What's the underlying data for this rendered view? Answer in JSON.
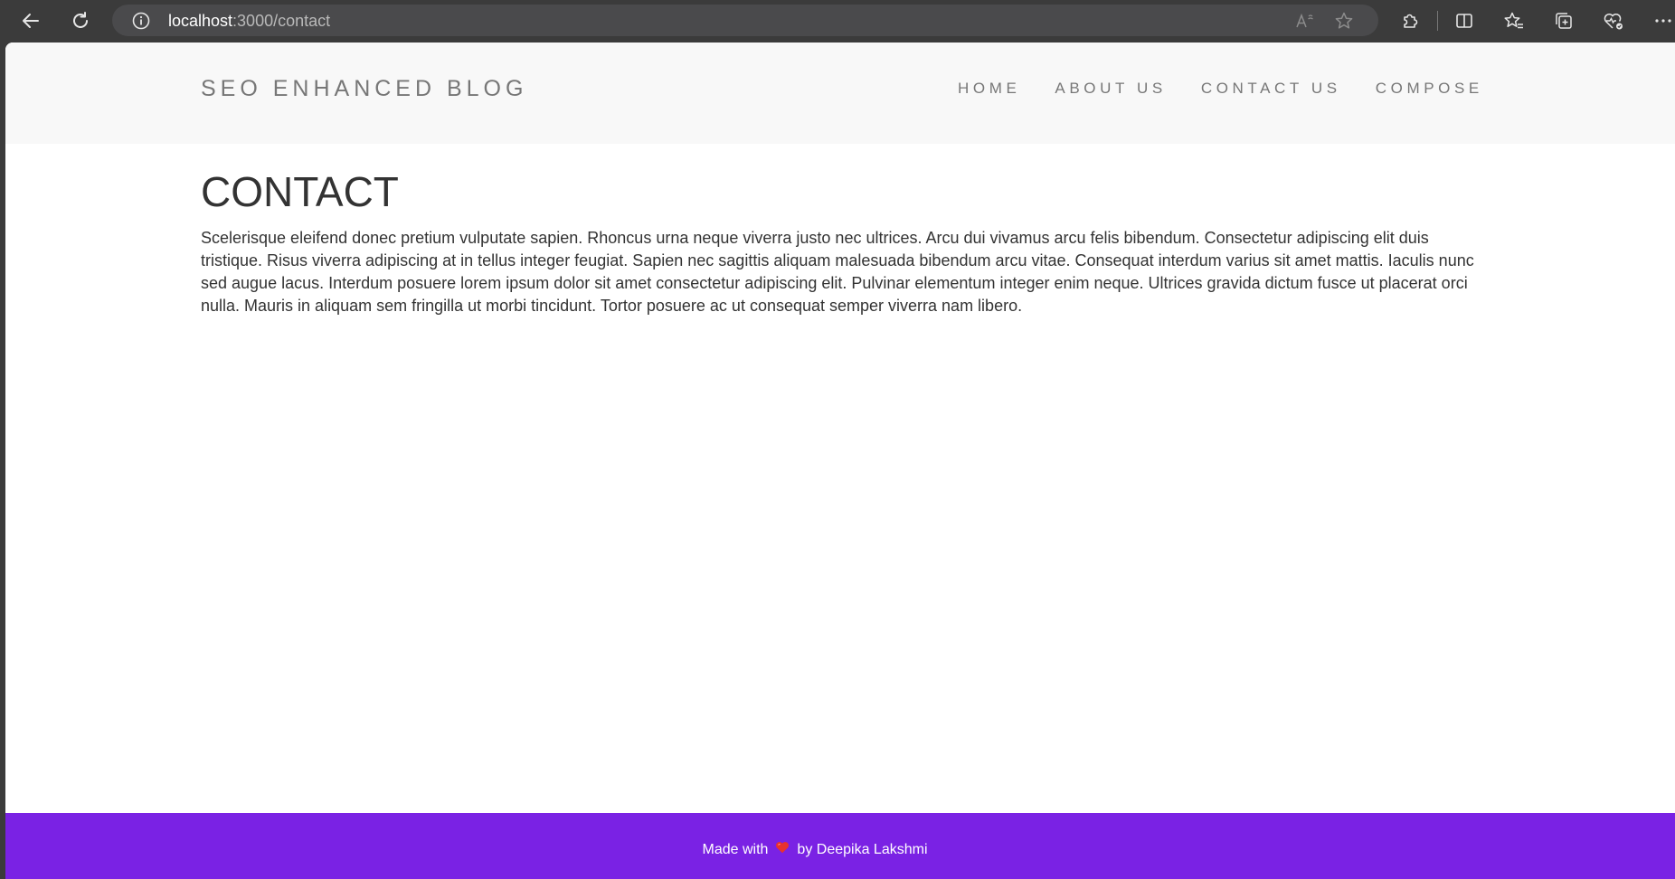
{
  "browser": {
    "url_host": "localhost",
    "url_path": ":3000/contact"
  },
  "site": {
    "brand": "SEO ENHANCED BLOG",
    "nav": [
      {
        "label": "HOME"
      },
      {
        "label": "ABOUT US"
      },
      {
        "label": "CONTACT US"
      },
      {
        "label": "COMPOSE"
      }
    ]
  },
  "page": {
    "heading": "CONTACT",
    "body": "Scelerisque eleifend donec pretium vulputate sapien. Rhoncus urna neque viverra justo nec ultrices. Arcu dui vivamus arcu felis bibendum. Consectetur adipiscing elit duis tristique. Risus viverra adipiscing at in tellus integer feugiat. Sapien nec sagittis aliquam malesuada bibendum arcu vitae. Consequat interdum varius sit amet mattis. Iaculis nunc sed augue lacus. Interdum posuere lorem ipsum dolor sit amet consectetur adipiscing elit. Pulvinar elementum integer enim neque. Ultrices gravida dictum fusce ut placerat orci nulla. Mauris in aliquam sem fringilla ut morbi tincidunt. Tortor posuere ac ut consequat semper viverra nam libero."
  },
  "footer": {
    "made_with": "Made with",
    "by": "by Deepika Lakshmi",
    "heart_icon": "heart-icon"
  },
  "colors": {
    "footer_bg": "#7a22e4",
    "navbar_bg": "#f8f8f8",
    "heart": "#e8322e"
  }
}
